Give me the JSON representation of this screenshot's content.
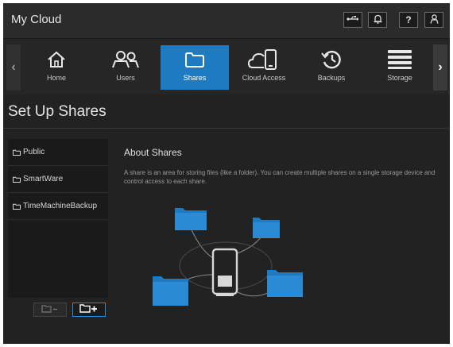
{
  "app": {
    "title": "My Cloud"
  },
  "topbar": {
    "buttons": [
      {
        "icon": "usb-icon"
      },
      {
        "icon": "bell-icon"
      },
      {
        "icon": "help-icon",
        "glyph": "?"
      },
      {
        "icon": "user-icon"
      }
    ]
  },
  "nav": {
    "items": [
      {
        "label": "Home",
        "icon": "home-icon"
      },
      {
        "label": "Users",
        "icon": "users-icon"
      },
      {
        "label": "Shares",
        "icon": "folder-icon",
        "active": true
      },
      {
        "label": "Cloud Access",
        "icon": "cloud-device-icon"
      },
      {
        "label": "Backups",
        "icon": "history-icon"
      },
      {
        "label": "Storage",
        "icon": "storage-icon"
      }
    ]
  },
  "page": {
    "title": "Set Up Shares"
  },
  "shares": {
    "items": [
      {
        "label": "Public"
      },
      {
        "label": "SmartWare"
      },
      {
        "label": "TimeMachineBackup"
      }
    ]
  },
  "about": {
    "title": "About Shares",
    "text": "A share is an area for storing files (like a folder). You can create multiple shares on a single storage device and control access to each share."
  },
  "colors": {
    "accent": "#1e7bc2",
    "folder": "#1e7bc2",
    "background": "#222222"
  }
}
